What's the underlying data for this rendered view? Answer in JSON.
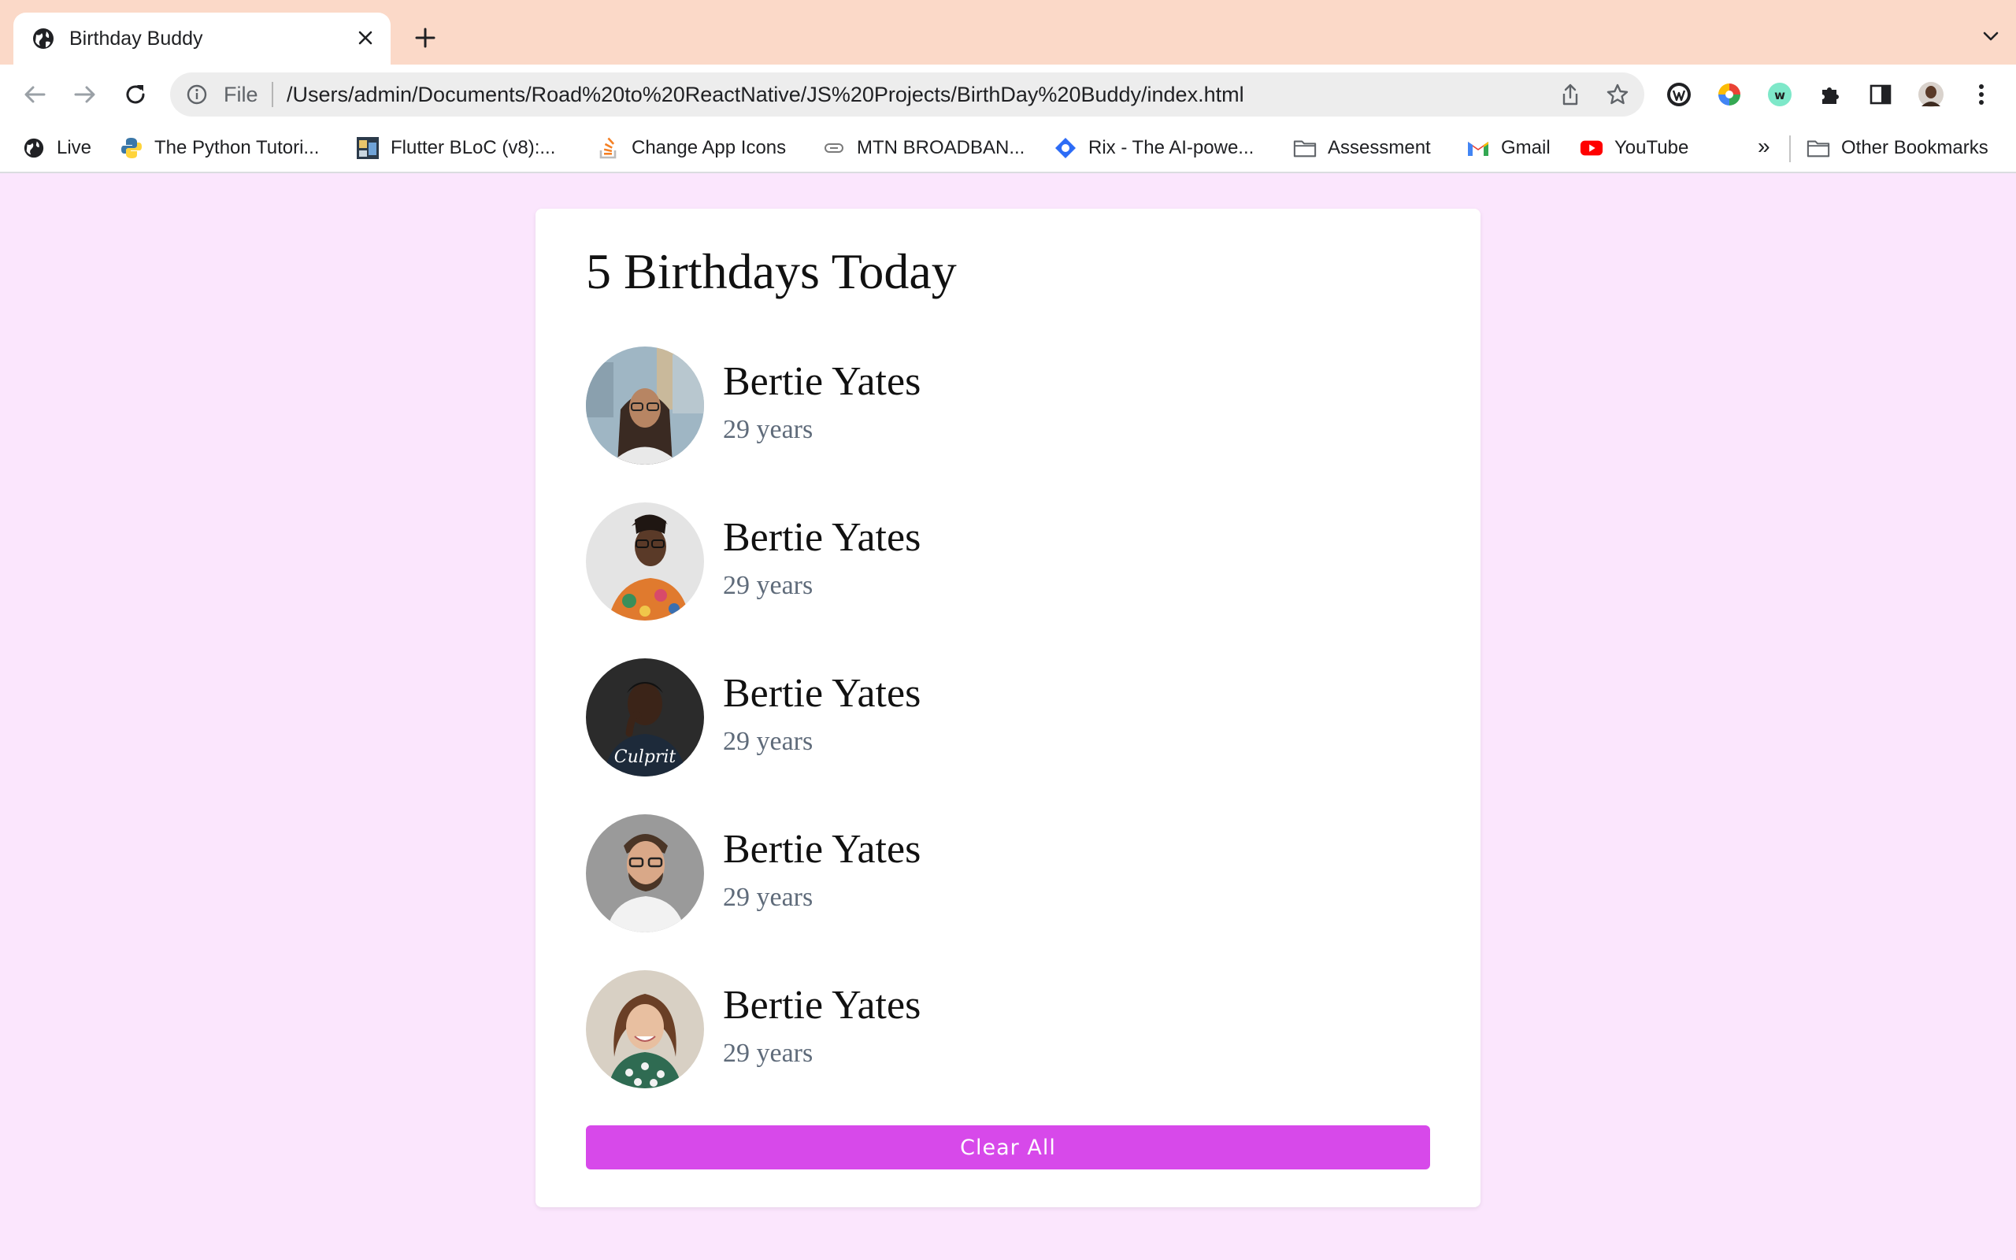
{
  "browser": {
    "tab": {
      "title": "Birthday Buddy"
    },
    "omnibox": {
      "scheme": "File",
      "url": "/Users/admin/Documents/Road%20to%20ReactNative/JS%20Projects/BirthDay%20Buddy/index.html"
    },
    "bookmarks": [
      {
        "label": "Live",
        "icon": "globe-icon"
      },
      {
        "label": "The Python Tutori...",
        "icon": "python-icon"
      },
      {
        "label": "Flutter BLoC (v8):...",
        "icon": "flutter-thumbnail-icon"
      },
      {
        "label": "Change App Icons",
        "icon": "stackoverflow-icon"
      },
      {
        "label": "MTN BROADBAN...",
        "icon": "link-icon"
      },
      {
        "label": "Rix - The AI-powe...",
        "icon": "rix-icon"
      },
      {
        "label": "Assessment",
        "icon": "folder-icon"
      },
      {
        "label": "Gmail",
        "icon": "gmail-icon"
      },
      {
        "label": "YouTube",
        "icon": "youtube-icon"
      }
    ],
    "overflow": "»",
    "other_bookmarks": "Other Bookmarks"
  },
  "app": {
    "heading": "5 Birthdays Today",
    "people": [
      {
        "name": "Bertie Yates",
        "age": "29 years"
      },
      {
        "name": "Bertie Yates",
        "age": "29 years"
      },
      {
        "name": "Bertie Yates",
        "age": "29 years"
      },
      {
        "name": "Bertie Yates",
        "age": "29 years"
      },
      {
        "name": "Bertie Yates",
        "age": "29 years"
      }
    ],
    "clear_label": "Clear All"
  },
  "colors": {
    "page_bg": "#fbe6fd",
    "tabstrip_bg": "#fbd9c8",
    "button_bg": "#d749ea",
    "age_text": "#5f6b7a"
  }
}
